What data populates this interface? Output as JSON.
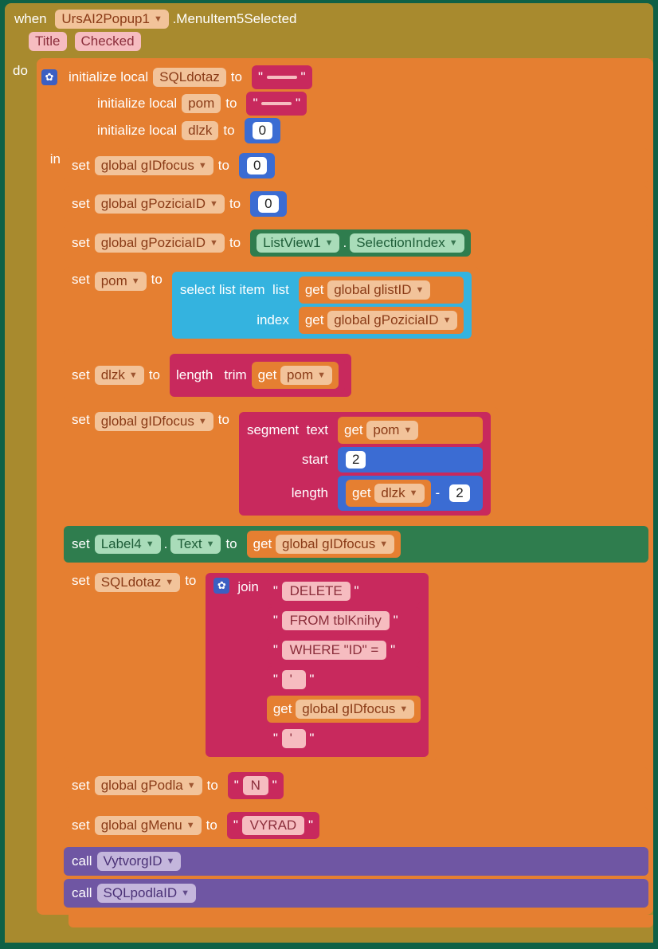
{
  "header": {
    "when": "when",
    "component": "UrsAI2Popup1",
    "event": ".MenuItem5Selected",
    "params": {
      "title": "Title",
      "checked": "Checked"
    }
  },
  "kw": {
    "do": "do",
    "in": "in",
    "init": "initialize local",
    "to": "to",
    "set": "set",
    "get": "get",
    "call": "call",
    "dot": "."
  },
  "locals": {
    "sql": {
      "name": "SQLdotaz",
      "val": " "
    },
    "pom": {
      "name": "pom",
      "val": " "
    },
    "dlzk": {
      "name": "dlzk",
      "val": "0"
    }
  },
  "vars": {
    "gIDfocus": "global gIDfocus",
    "gPoziciaID": "global gPoziciaID",
    "glistID": "global glistID",
    "gPodla": "global gPodla",
    "gMenu": "global gMenu",
    "pom": "pom",
    "dlzk": "dlzk",
    "sql": "SQLdotaz"
  },
  "num": {
    "zero1": "0",
    "zero2": "0",
    "two1": "2",
    "two2": "2"
  },
  "textops": {
    "length": "length",
    "trim": "trim",
    "segment": "segment",
    "text": "text",
    "start": "start",
    "len": "length",
    "join": "join"
  },
  "listops": {
    "select": "select list item",
    "list": "list",
    "index": "index"
  },
  "listview": {
    "comp": "ListView1",
    "prop": "SelectionIndex"
  },
  "label4": {
    "comp": "Label4",
    "prop": "Text"
  },
  "sqljoin": {
    "s1": "DELETE ",
    "s2": " FROM tblKnihy ",
    "s3": " WHERE \"ID\"  = ",
    "s4": "'",
    "s6": "'"
  },
  "vals": {
    "N": "N",
    "vyrad": "VYRAD"
  },
  "math": {
    "minus": "-"
  },
  "procs": {
    "p1": "VytvorgID",
    "p2": "SQLpodlaID"
  },
  "q": "\""
}
